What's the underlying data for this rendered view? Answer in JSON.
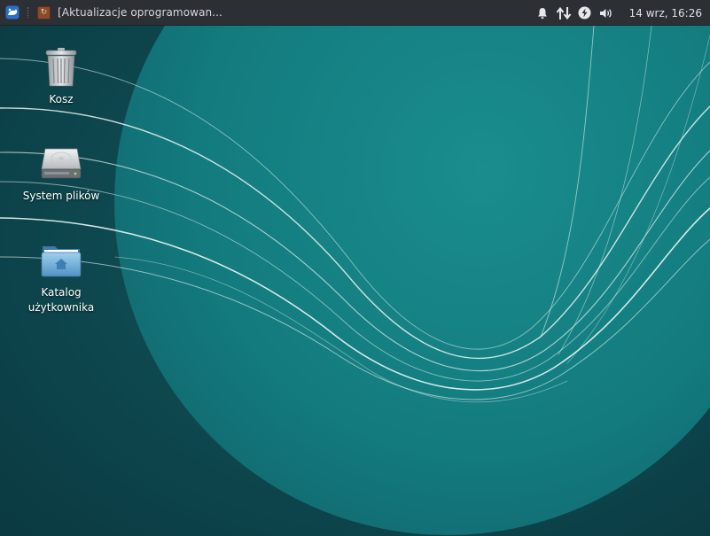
{
  "panel": {
    "taskbar_item": "[Aktualizacje oprogramowan...",
    "clock": "14 wrz, 16:26"
  },
  "desktop": {
    "icons": [
      {
        "label": "Kosz",
        "icon": "trash-icon"
      },
      {
        "label": "System plików",
        "icon": "hard-drive-icon"
      },
      {
        "label": "Katalog użytkownika",
        "icon": "home-folder-icon"
      }
    ]
  },
  "colors": {
    "panel_bg": "#2c2f33",
    "wallpaper_dark": "#0e3f46",
    "wallpaper_circle": "#17888a"
  }
}
